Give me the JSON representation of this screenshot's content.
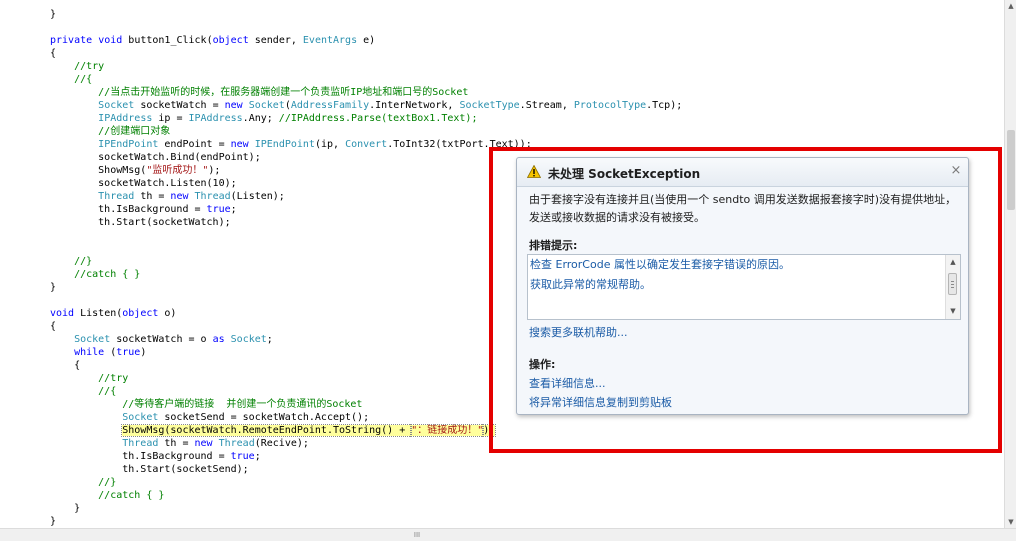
{
  "code": {
    "lines": [
      [
        [
          "}",
          "pl"
        ]
      ],
      [],
      [
        [
          "private",
          "kw"
        ],
        [
          " ",
          "pl"
        ],
        [
          "void",
          "kw"
        ],
        [
          " button1_Click(",
          "pl"
        ],
        [
          "object",
          "kw"
        ],
        [
          " sender, ",
          "pl"
        ],
        [
          "EventArgs",
          "ty"
        ],
        [
          " e)",
          "pl"
        ]
      ],
      [
        [
          "{",
          "pl"
        ]
      ],
      [
        [
          "    //try",
          "cm"
        ]
      ],
      [
        [
          "    //{",
          "cm"
        ]
      ],
      [
        [
          "        //当点击开始监听的时候，在服务器端创建一个负责监听IP地址和端口号的Socket",
          "cm"
        ]
      ],
      [
        [
          "        ",
          "pl"
        ],
        [
          "Socket",
          "ty"
        ],
        [
          " socketWatch = ",
          "pl"
        ],
        [
          "new",
          "kw"
        ],
        [
          " ",
          "pl"
        ],
        [
          "Socket",
          "ty"
        ],
        [
          "(",
          "pl"
        ],
        [
          "AddressFamily",
          "ty"
        ],
        [
          ".InterNetwork, ",
          "pl"
        ],
        [
          "SocketType",
          "ty"
        ],
        [
          ".Stream, ",
          "pl"
        ],
        [
          "ProtocolType",
          "ty"
        ],
        [
          ".Tcp);",
          "pl"
        ]
      ],
      [
        [
          "        ",
          "pl"
        ],
        [
          "IPAddress",
          "ty"
        ],
        [
          " ip = ",
          "pl"
        ],
        [
          "IPAddress",
          "ty"
        ],
        [
          ".Any; ",
          "pl"
        ],
        [
          "//IPAddress.Parse(textBox1.Text);",
          "cm"
        ]
      ],
      [
        [
          "        //创建端口对象",
          "cm"
        ]
      ],
      [
        [
          "        ",
          "pl"
        ],
        [
          "IPEndPoint",
          "ty"
        ],
        [
          " endPoint = ",
          "pl"
        ],
        [
          "new",
          "kw"
        ],
        [
          " ",
          "pl"
        ],
        [
          "IPEndPoint",
          "ty"
        ],
        [
          "(ip, ",
          "pl"
        ],
        [
          "Convert",
          "ty"
        ],
        [
          ".ToInt32(txtPort.Text));",
          "pl"
        ]
      ],
      [
        [
          "        socketWatch.Bind(endPoint);",
          "pl"
        ]
      ],
      [
        [
          "        ShowMsg(",
          "pl"
        ],
        [
          "\"监听成功！\"",
          "st"
        ],
        [
          ");",
          "pl"
        ]
      ],
      [
        [
          "        socketWatch.Listen(10);",
          "pl"
        ]
      ],
      [
        [
          "        ",
          "pl"
        ],
        [
          "Thread",
          "ty"
        ],
        [
          " th = ",
          "pl"
        ],
        [
          "new",
          "kw"
        ],
        [
          " ",
          "pl"
        ],
        [
          "Thread",
          "ty"
        ],
        [
          "(Listen);",
          "pl"
        ]
      ],
      [
        [
          "        th.IsBackground = ",
          "pl"
        ],
        [
          "true",
          "kw"
        ],
        [
          ";",
          "pl"
        ]
      ],
      [
        [
          "        th.Start(socketWatch);",
          "pl"
        ]
      ],
      [],
      [],
      [
        [
          "    //}",
          "cm"
        ]
      ],
      [
        [
          "    //catch { }",
          "cm"
        ]
      ],
      [
        [
          "}",
          "pl"
        ]
      ],
      [],
      [
        [
          "void",
          "kw"
        ],
        [
          " Listen(",
          "pl"
        ],
        [
          "object",
          "kw"
        ],
        [
          " o)",
          "pl"
        ]
      ],
      [
        [
          "{",
          "pl"
        ]
      ],
      [
        [
          "    ",
          "pl"
        ],
        [
          "Socket",
          "ty"
        ],
        [
          " socketWatch = o ",
          "pl"
        ],
        [
          "as",
          "kw"
        ],
        [
          " ",
          "pl"
        ],
        [
          "Socket",
          "ty"
        ],
        [
          ";",
          "pl"
        ]
      ],
      [
        [
          "    ",
          "pl"
        ],
        [
          "while",
          "kw"
        ],
        [
          " (",
          "pl"
        ],
        [
          "true",
          "kw"
        ],
        [
          ")",
          "pl"
        ]
      ],
      [
        [
          "    {",
          "pl"
        ]
      ],
      [
        [
          "        //try",
          "cm"
        ]
      ],
      [
        [
          "        //{",
          "cm"
        ]
      ],
      [
        [
          "            //等待客户端的链接  并创建一个负责通讯的Socket",
          "cm"
        ]
      ],
      [
        [
          "            ",
          "pl"
        ],
        [
          "Socket",
          "ty"
        ],
        [
          " socketSend = socketWatch.Accept();",
          "pl"
        ]
      ],
      [
        [
          "            ",
          "pl"
        ],
        [
          "ShowMsg(socketWatch.RemoteEndPoint.ToString() + ",
          "hl"
        ],
        [
          "\"：链接成功！\"",
          "hls"
        ],
        [
          ");",
          "hl"
        ]
      ],
      [
        [
          "            ",
          "pl"
        ],
        [
          "Thread",
          "ty"
        ],
        [
          " th = ",
          "pl"
        ],
        [
          "new",
          "kw"
        ],
        [
          " ",
          "pl"
        ],
        [
          "Thread",
          "ty"
        ],
        [
          "(Recive);",
          "pl"
        ]
      ],
      [
        [
          "            th.IsBackground = ",
          "pl"
        ],
        [
          "true",
          "kw"
        ],
        [
          ";",
          "pl"
        ]
      ],
      [
        [
          "            th.Start(socketSend);",
          "pl"
        ]
      ],
      [
        [
          "        //}",
          "cm"
        ]
      ],
      [
        [
          "        //catch { }",
          "cm"
        ]
      ],
      [
        [
          "    }",
          "pl"
        ]
      ],
      [
        [
          "}",
          "pl"
        ]
      ]
    ]
  },
  "exception": {
    "title": "未处理 SocketException",
    "close_glyph": "×",
    "message": "由于套接字没有连接并且(当使用一个 sendto 调用发送数据报套接字时)没有提供地址，发送或接收数据的请求没有被接受。",
    "tips_heading": "排错提示:",
    "tips": [
      "检查 ErrorCode 属性以确定发生套接字错误的原因。",
      "获取此异常的常规帮助。"
    ],
    "search_help": "搜索更多联机帮助...",
    "actions_heading": "操作:",
    "actions": [
      "查看详细信息...",
      "将异常详细信息复制到剪贴板"
    ]
  },
  "scrollbars": {
    "up_arrow": "▲",
    "down_arrow": "▼",
    "h_thumb_glyph": "III"
  },
  "colors": {
    "keyword": "#0000ff",
    "type": "#2b91af",
    "comment": "#008000",
    "string": "#a31515",
    "highlight_bg": "#ffff9c",
    "annotation_frame": "#e40000",
    "link": "#1a5ba6",
    "warning_icon": "#f5c400"
  },
  "icons": {
    "dialog_icon": "warning-icon",
    "close_icon": "close-icon"
  }
}
